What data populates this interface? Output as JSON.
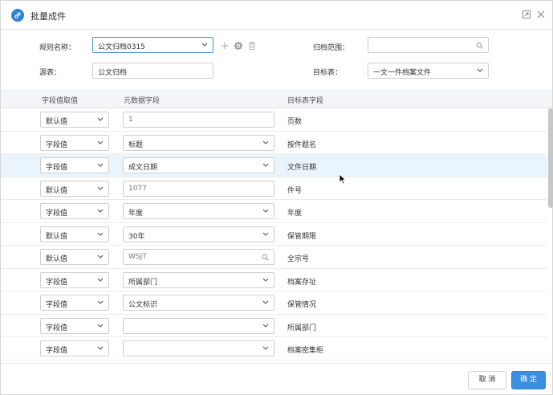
{
  "dialog": {
    "title": "批量成件",
    "icons": {
      "title": "link-icon",
      "maximize": "maximize-icon",
      "close": "close-icon"
    }
  },
  "form": {
    "rule_name_label": "规则名称：",
    "rule_name_value": "公文归档0315",
    "source_table_label": "源表：",
    "source_table_value": "公文归档",
    "archive_scope_label": "归档范围：",
    "archive_scope_value": "",
    "target_table_label": "目标表：",
    "target_table_value": "一文一件档案文件",
    "tool_icons": [
      "plus-icon",
      "gear-icon",
      "trash-icon"
    ]
  },
  "table": {
    "headers": [
      "字段值取值",
      "元数据字段",
      "目标表字段"
    ],
    "rows": [
      {
        "mode": "默认值",
        "source": "1",
        "source_kind": "input",
        "target": "页数"
      },
      {
        "mode": "字段值",
        "source": "标题",
        "source_kind": "select",
        "target": "按件题名"
      },
      {
        "mode": "字段值",
        "source": "成文日期",
        "source_kind": "select",
        "target": "文件日期"
      },
      {
        "mode": "默认值",
        "source": "1077",
        "source_kind": "input",
        "target": "件号"
      },
      {
        "mode": "字段值",
        "source": "年度",
        "source_kind": "select",
        "target": "年度"
      },
      {
        "mode": "默认值",
        "source": "30年",
        "source_kind": "select",
        "target": "保管期限"
      },
      {
        "mode": "默认值",
        "source": "WSJT",
        "source_kind": "search",
        "target": "全宗号"
      },
      {
        "mode": "字段值",
        "source": "所属部门",
        "source_kind": "select",
        "target": "档案存址"
      },
      {
        "mode": "字段值",
        "source": "公文标识",
        "source_kind": "select",
        "target": "保管情况"
      },
      {
        "mode": "字段值",
        "source": "",
        "source_kind": "select",
        "target": "所属部门"
      },
      {
        "mode": "字段值",
        "source": "",
        "source_kind": "select",
        "target": "档案密集柜"
      }
    ],
    "highlighted_row": 2
  },
  "footer": {
    "cancel_label": "取 消",
    "ok_label": "确 定"
  },
  "colors": {
    "accent": "#3b8fe0",
    "row_highlight": "#e9f4fc",
    "header_bg": "#f3f5f8",
    "border": "#cfcfcf"
  }
}
